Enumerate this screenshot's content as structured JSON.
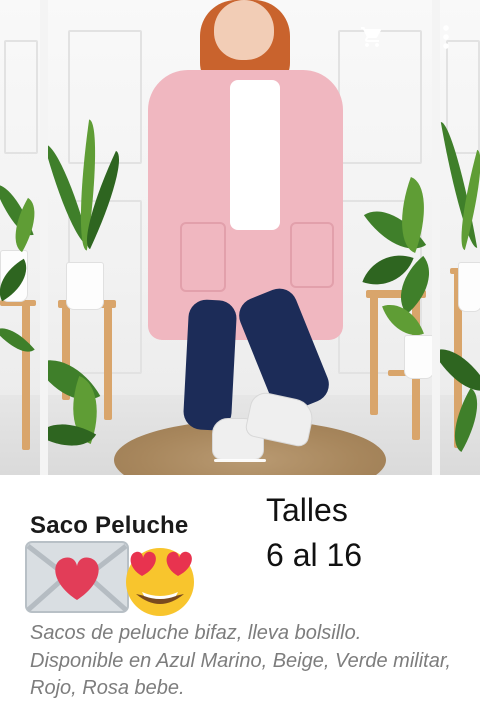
{
  "toolbar": {
    "cart_icon": "shopping-cart-icon",
    "more_icon": "more-vertical-icon"
  },
  "carousel": {
    "slide_count_visible": 3,
    "active_slide_description_hidden": ""
  },
  "product": {
    "title": "Saco Peluche",
    "sizes_label": "Talles",
    "sizes_range": "6 al 16",
    "emojis": [
      "love-letter-emoji",
      "heart-eyes-emoji"
    ],
    "description": "Sacos de peluche bifaz, lleva bolsillo. Disponible en Azul Marino, Beige, Verde militar, Rojo, Rosa bebe."
  },
  "colors": {
    "title": "#1a1a1a",
    "description": "#7d7d7d",
    "coat": "#f0b7c0",
    "jeans": "#1c2c58"
  }
}
